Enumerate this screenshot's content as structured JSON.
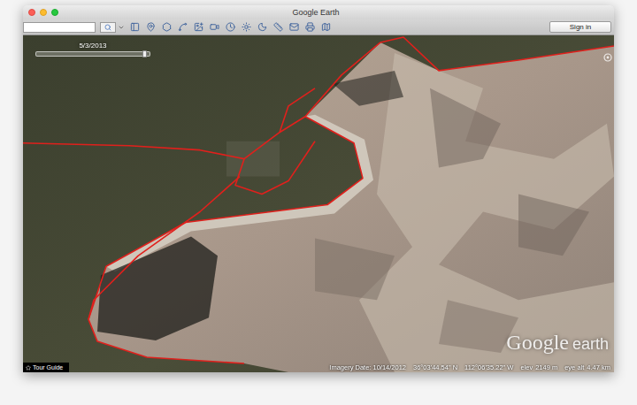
{
  "window": {
    "title": "Google Earth"
  },
  "toolbar": {
    "search": {
      "value": ""
    },
    "sign_in": "Sign in"
  },
  "time_slider": {
    "date": "5/3/2013",
    "level": 0.96
  },
  "map": {
    "logo": {
      "brand": "Google",
      "product": "earth"
    }
  },
  "status_bar": {
    "tour_guide": "Tour Guide",
    "imagery_date": "Imagery Date: 10/14/2012",
    "latitude": "36°03'44.54\" N",
    "longitude": "112°06'35.22\" W",
    "elev_label": "elev",
    "elev": "2149 m",
    "eye_alt_label": "eye alt",
    "eye_alt": "4.47 km"
  }
}
